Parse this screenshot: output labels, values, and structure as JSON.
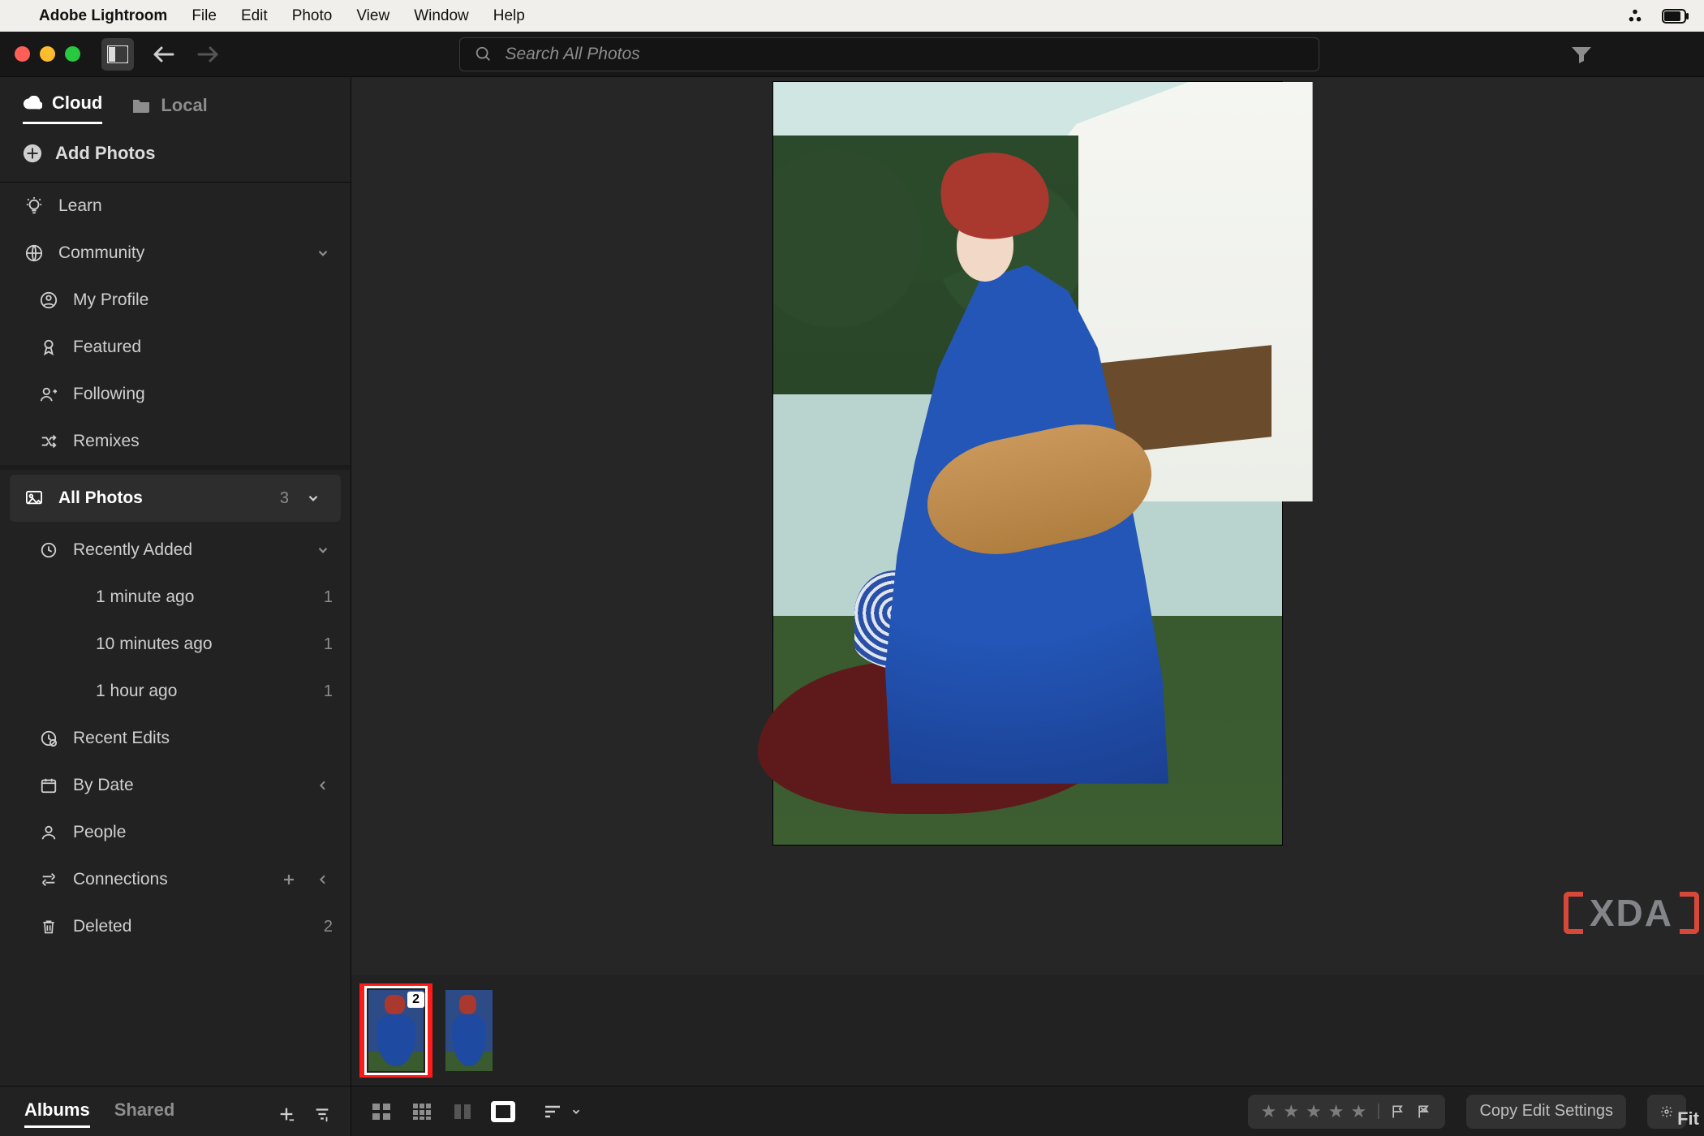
{
  "mac_menubar": {
    "app_name": "Adobe Lightroom",
    "items": [
      "File",
      "Edit",
      "Photo",
      "View",
      "Window",
      "Help"
    ]
  },
  "toolbar": {
    "search_placeholder": "Search All Photos"
  },
  "sidebar": {
    "tabs": {
      "cloud": "Cloud",
      "local": "Local"
    },
    "add_photos": "Add Photos",
    "learn": "Learn",
    "community": {
      "label": "Community",
      "my_profile": "My Profile",
      "featured": "Featured",
      "following": "Following",
      "remixes": "Remixes"
    },
    "all_photos": {
      "label": "All Photos",
      "count": "3"
    },
    "recently_added": {
      "label": "Recently Added",
      "items": [
        {
          "label": "1 minute ago",
          "count": "1"
        },
        {
          "label": "10 minutes ago",
          "count": "1"
        },
        {
          "label": "1 hour ago",
          "count": "1"
        }
      ]
    },
    "recent_edits": "Recent Edits",
    "by_date": "By Date",
    "people": "People",
    "connections": "Connections",
    "deleted": {
      "label": "Deleted",
      "count": "2"
    },
    "bottom_tabs": {
      "albums": "Albums",
      "shared": "Shared"
    }
  },
  "filmstrip": {
    "selected_stack_count": "2"
  },
  "bottombar": {
    "copy_edit_label": "Copy Edit Settings",
    "fit_label": "Fit"
  },
  "watermark": {
    "text": "XDA"
  },
  "colors": {
    "accent_blue": "#1e4aa1",
    "highlight_red": "#ff1a1a"
  }
}
